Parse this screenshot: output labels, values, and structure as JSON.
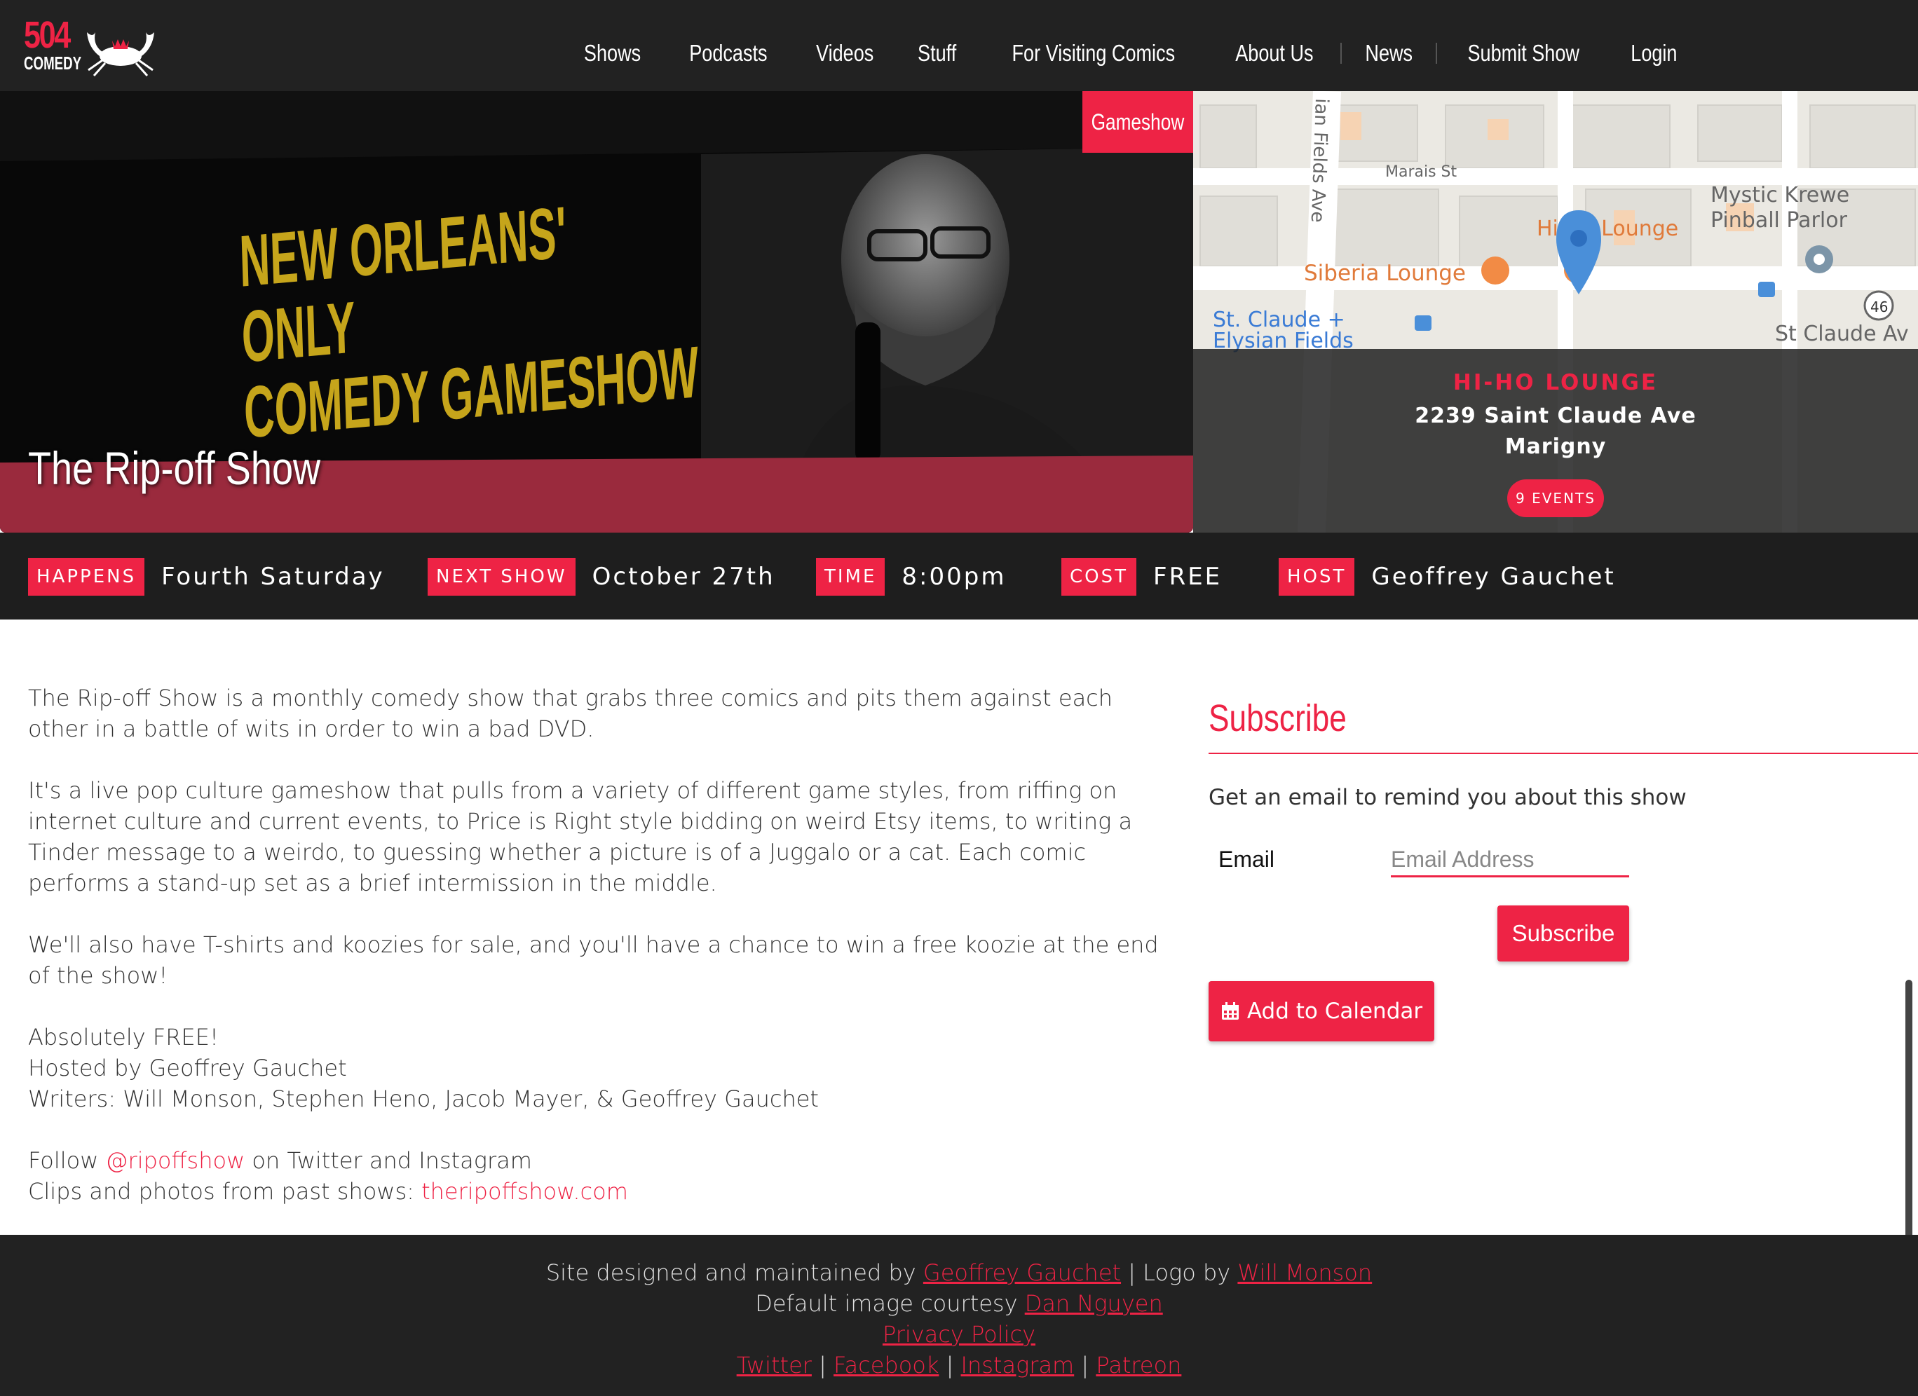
{
  "nav": {
    "logo_number": "504",
    "logo_word": "COMEDY",
    "links": [
      "Shows",
      "Podcasts",
      "Videos",
      "Stuff",
      "For Visiting Comics",
      "About Us",
      "News",
      "Submit Show",
      "Login"
    ]
  },
  "hero": {
    "title": "The Rip-off Show",
    "genre": "Gameshow",
    "slogan": [
      "NEW ORLEANS'",
      "ONLY",
      "COMEDY GAMESHOW"
    ]
  },
  "map": {
    "labels": {
      "marais": "Marais St",
      "elysian_top": "ian Fields Ave",
      "mystic1": "Mystic Krewe",
      "mystic2": "Pinball Parlor",
      "hiho": "Hi-Ho Lounge",
      "siberia": "Siberia Lounge",
      "stclaude1": "St. Claude +",
      "stclaude2": "Elysian Fields",
      "stclaude_av": "St Claude Av",
      "route": "46"
    },
    "venue": {
      "name": "HI-HO LOUNGE",
      "address": "2239 Saint Claude Ave",
      "neighborhood": "Marigny",
      "events": "9 EVENTS"
    }
  },
  "info": {
    "happens_label": "Happens",
    "happens": "Fourth Saturday",
    "next_label": "Next Show",
    "next": "October 27th",
    "time_label": "Time",
    "time": "8:00pm",
    "cost_label": "Cost",
    "cost": "FREE",
    "host_label": "Host",
    "host": "Geoffrey Gauchet"
  },
  "description": {
    "p1": "The Rip-off Show is a monthly comedy show that grabs three comics and pits them against each other in a battle of wits in order to win a bad DVD.",
    "p2": "It's a live pop culture gameshow that pulls from a variety of different game styles, from riffing on internet culture and current events, to Price is Right style bidding on weird Etsy items, to writing a Tinder message to a weirdo, to guessing whether a picture is of a Juggalo or a cat. Each comic performs a stand-up set as a brief intermission in the middle.",
    "p3": "We'll also have T-shirts and koozies for sale, and you'll have a chance to win a free koozie at the end of the show!",
    "free": "Absolutely FREE!",
    "hosted": "Hosted by Geoffrey Gauchet",
    "writers": "Writers: Will Monson, Stephen Heno, Jacob Mayer, & Geoffrey Gauchet",
    "follow_pre": "Follow ",
    "follow_handle": "@ripoffshow",
    "follow_post": " on Twitter and Instagram",
    "clips_pre": "Clips and photos from past shows: ",
    "clips_link": "theripoffshow.com"
  },
  "subscribe": {
    "title": "Subscribe",
    "text": "Get an email to remind you about this show",
    "email_label": "Email",
    "email_placeholder": "Email Address",
    "button": "Subscribe",
    "calendar": "Add to Calendar"
  },
  "footer": {
    "designed_pre": "Site designed and maintained by ",
    "designer": "Geoffrey Gauchet",
    "logo_pre": " | Logo by ",
    "logo_by": "Will Monson",
    "image_pre": "Default image courtesy ",
    "image_by": "Dan Nguyen",
    "privacy": "Privacy Policy",
    "social": [
      "Twitter",
      "Facebook",
      "Instagram",
      "Patreon"
    ],
    "sep": " | "
  },
  "colors": {
    "accent": "#ee2345",
    "dark": "#222222",
    "slogan": "#c6a51b"
  }
}
